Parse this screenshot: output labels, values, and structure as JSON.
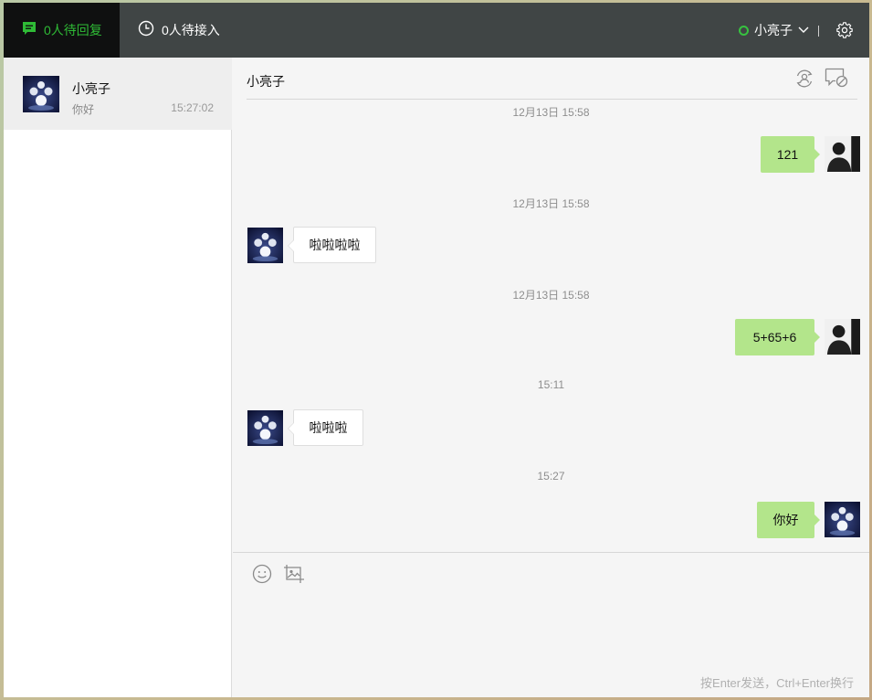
{
  "topbar": {
    "tab_reply_label": "0人待回复",
    "tab_queue_label": "0人待接入",
    "user_name": "小亮子",
    "status_color": "#37c240",
    "accent_color": "#2fbb36"
  },
  "sidebar": {
    "conversations": [
      {
        "name": "小亮子",
        "preview": "你好",
        "time": "15:27:02"
      }
    ]
  },
  "chat": {
    "title": "小亮子",
    "messages": [
      {
        "timestamp": "12月13日 15:58",
        "direction": "out",
        "text": "121",
        "avatar": "portrait-avatar"
      },
      {
        "timestamp": "12月13日 15:58",
        "direction": "in",
        "text": "啦啦啦啦",
        "avatar": "moon-avatar"
      },
      {
        "timestamp": "12月13日 15:58",
        "direction": "out",
        "text": "5+65+6",
        "avatar": "portrait-avatar"
      },
      {
        "timestamp": "15:11",
        "direction": "in",
        "text": "啦啦啦",
        "avatar": "moon-avatar"
      },
      {
        "timestamp": "15:27",
        "direction": "out",
        "text": "你好",
        "avatar": "moon-avatar"
      }
    ]
  },
  "composer": {
    "input_value": "",
    "send_hint": "按Enter发送，Ctrl+Enter换行"
  },
  "icons": {
    "tab_reply": "chat-bubble-icon",
    "tab_queue": "clock-icon",
    "settings": "gear-icon",
    "transfer": "transfer-user-icon",
    "end_chat": "end-chat-icon",
    "emoji": "emoji-icon",
    "image": "image-icon"
  }
}
